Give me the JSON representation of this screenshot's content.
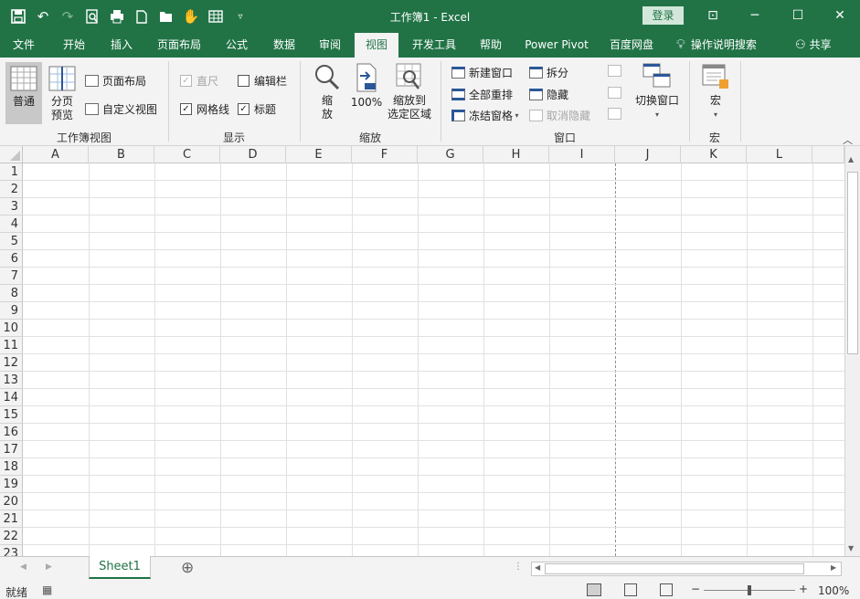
{
  "titlebar": {
    "title": "工作簿1  -  Excel",
    "login": "登录",
    "qat_icons": [
      "save-icon",
      "undo-icon",
      "redo-icon",
      "print-preview-icon",
      "print-icon",
      "new-icon",
      "open-icon",
      "touch-mode-icon",
      "table-icon",
      "customize-qat-icon"
    ],
    "window_buttons": {
      "ribbon_display": "⊡",
      "minimize": "─",
      "maximize": "☐",
      "close": "✕"
    }
  },
  "tabs": [
    "文件",
    "开始",
    "插入",
    "页面布局",
    "公式",
    "数据",
    "审阅",
    "视图",
    "开发工具",
    "帮助",
    "Power Pivot",
    "百度网盘"
  ],
  "active_tab": "视图",
  "tell_me": "操作说明搜索",
  "share": "共享",
  "ribbon": {
    "workbook_views": {
      "label": "工作簿视图",
      "normal": "普通",
      "page_break_1": "分页",
      "page_break_2": "预览",
      "page_layout": "页面布局",
      "custom_views": "自定义视图"
    },
    "show": {
      "label": "显示",
      "ruler": "直尺",
      "formula_bar": "编辑栏",
      "gridlines": "网格线",
      "headings": "标题"
    },
    "zoom": {
      "label": "缩放",
      "zoom_1": "缩",
      "zoom_2": "放",
      "zoom_100": "100%",
      "zoom_selection_1": "缩放到",
      "zoom_selection_2": "选定区域"
    },
    "window": {
      "label": "窗口",
      "new_window": "新建窗口",
      "arrange_all": "全部重排",
      "freeze_panes": "冻结窗格",
      "split": "拆分",
      "hide": "隐藏",
      "unhide": "取消隐藏",
      "switch_windows": "切换窗口"
    },
    "macros": {
      "label": "宏",
      "macros": "宏"
    }
  },
  "columns": [
    "A",
    "B",
    "C",
    "D",
    "E",
    "F",
    "G",
    "H",
    "I",
    "J",
    "K",
    "L"
  ],
  "rows": [
    "1",
    "2",
    "3",
    "4",
    "5",
    "6",
    "7",
    "8",
    "9",
    "10",
    "11",
    "12",
    "13",
    "14",
    "15",
    "16",
    "17",
    "18",
    "19",
    "20",
    "21",
    "22",
    "23"
  ],
  "sheets": [
    "Sheet1"
  ],
  "add_sheet": "⊕",
  "status": {
    "ready": "就绪",
    "zoom_level": "100%",
    "zoom_minus": "−",
    "zoom_plus": "+"
  },
  "colors": {
    "excel_green": "#217346",
    "ribbon_bg": "#f3f3f3"
  }
}
